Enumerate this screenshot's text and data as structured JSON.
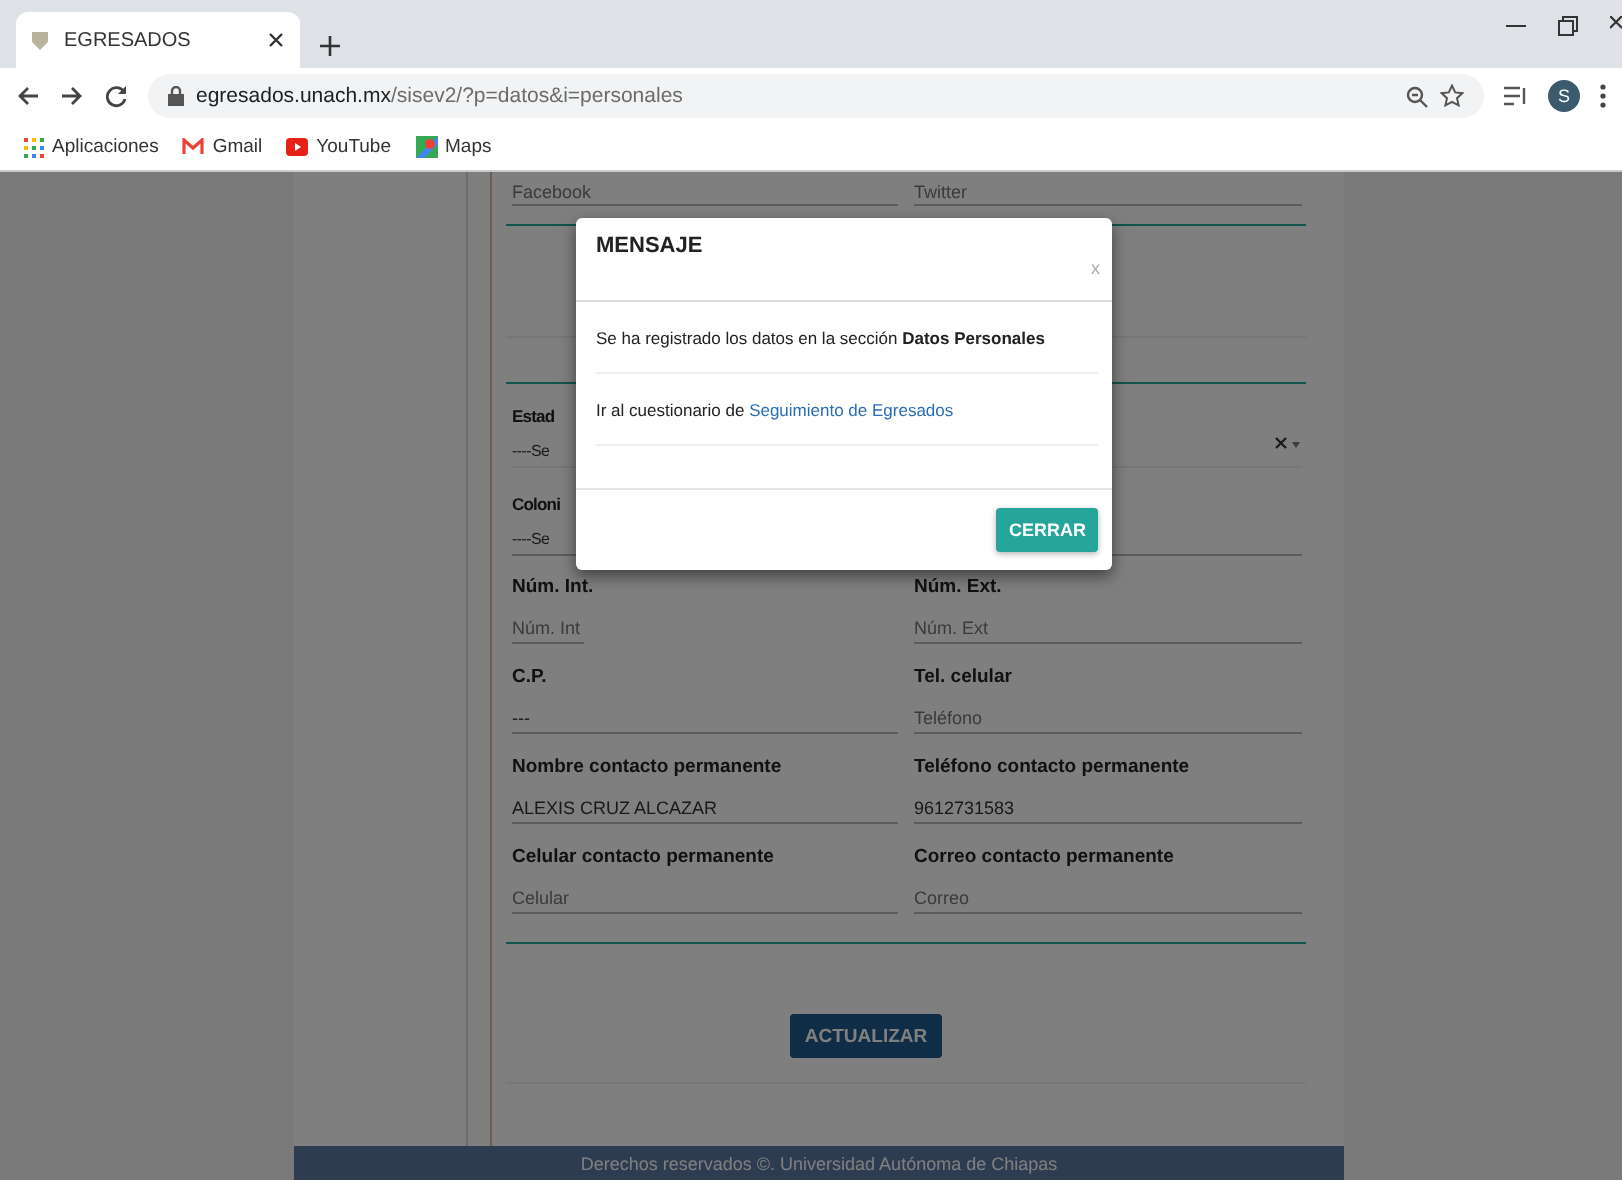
{
  "browser": {
    "tab_title": "EGRESADOS",
    "url": "egresados.unach.mx/sisev2/?p=datos&i=personales",
    "profile_initial": "S",
    "bookmarks": [
      {
        "kind": "apps",
        "label": "Aplicaciones"
      },
      {
        "kind": "gmail",
        "label": "Gmail"
      },
      {
        "kind": "youtube",
        "label": "YouTube"
      },
      {
        "kind": "maps",
        "label": "Maps"
      }
    ]
  },
  "form": {
    "social": [
      {
        "placeholder": "Facebook"
      },
      {
        "placeholder": "Twitter"
      }
    ],
    "selects": [
      {
        "label": "Estad",
        "value": "----Se",
        "clearable": true
      },
      {
        "label": "Coloni",
        "value": "----Se",
        "clearable": false
      }
    ],
    "rows": [
      [
        {
          "label": "Núm. Int.",
          "placeholder": "Núm. Int",
          "kind": "short"
        },
        {
          "label": "Núm. Ext.",
          "placeholder": "Núm. Ext",
          "kind": "full"
        }
      ],
      [
        {
          "label": "C.P.",
          "value": "---",
          "kind": "full"
        },
        {
          "label": "Tel. celular",
          "placeholder": "Teléfono",
          "kind": "full"
        }
      ],
      [
        {
          "label": "Nombre contacto permanente",
          "value": "ALEXIS CRUZ ALCAZAR",
          "kind": "full"
        },
        {
          "label": "Teléfono contacto permanente",
          "value": "9612731583",
          "kind": "full"
        }
      ],
      [
        {
          "label": "Celular contacto permanente",
          "placeholder": "Celular",
          "kind": "full"
        },
        {
          "label": "Correo contacto permanente",
          "placeholder": "Correo",
          "kind": "full"
        }
      ]
    ],
    "submit": "ACTUALIZAR"
  },
  "footer": "Derechos reservados ©. Universidad Autónoma de Chiapas",
  "modal": {
    "title": "MENSAJE",
    "close": "x",
    "message": "Se ha registrado los datos en la sección **Datos Personales**",
    "link_prefix": "Ir al cuestionario de",
    "link": "Seguimiento de Egresados",
    "button": "CERRAR"
  }
}
